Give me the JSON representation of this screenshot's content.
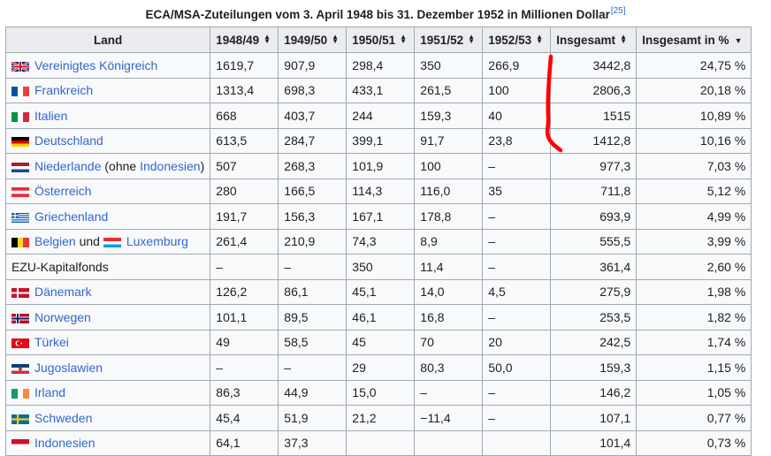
{
  "caption": {
    "title": "ECA/MSA-Zuteilungen vom 3. April 1948 bis 31. Dezember 1952 in Millionen Dollar",
    "ref": "[25]"
  },
  "table": {
    "headers": [
      "Land",
      "1948/49",
      "1949/50",
      "1950/51",
      "1951/52",
      "1952/53",
      "Insgesamt",
      "Insgesamt in %"
    ],
    "rows": [
      {
        "country": "Vereinigtes Königreich",
        "flag": "uk-flag-icon",
        "values": [
          "1619,7",
          "907,9",
          "298,4",
          "350",
          "266,9",
          "3442,8",
          "24,75 %"
        ]
      },
      {
        "country": "Frankreich",
        "flag": "france-flag-icon",
        "values": [
          "1313,4",
          "698,3",
          "433,1",
          "261,5",
          "100",
          "2806,3",
          "20,18 %"
        ]
      },
      {
        "country": "Italien",
        "flag": "italy-flag-icon",
        "values": [
          "668",
          "403,7",
          "244",
          "159,3",
          "40",
          "1515",
          "10,89 %"
        ]
      },
      {
        "country": "Deutschland",
        "flag": "germany-flag-icon",
        "values": [
          "613,5",
          "284,7",
          "399,1",
          "91,7",
          "23,8",
          "1412,8",
          "10,16 %"
        ]
      },
      {
        "country": "Niederlande",
        "suffix_pre": " (ohne ",
        "suffix_link": "Indonesien",
        "suffix_post": ")",
        "flag": "netherlands-flag-icon",
        "values": [
          "507",
          "268,3",
          "101,9",
          "100",
          "–",
          "977,3",
          "7,03 %"
        ]
      },
      {
        "country": "Österreich",
        "flag": "austria-flag-icon",
        "values": [
          "280",
          "166,5",
          "114,3",
          "116,0",
          "35",
          "711,8",
          "5,12 %"
        ]
      },
      {
        "country": "Griechenland",
        "flag": "greece-flag-icon",
        "values": [
          "191,7",
          "156,3",
          "167,1",
          "178,8",
          "–",
          "693,9",
          "4,99 %"
        ]
      },
      {
        "country": "Belgien",
        "mid": " und ",
        "country2": "Luxemburg",
        "flag": "belgium-flag-icon",
        "flag2": "luxembourg-flag-icon",
        "values": [
          "261,4",
          "210,9",
          "74,3",
          "8,9",
          "–",
          "555,5",
          "3,99 %"
        ]
      },
      {
        "country": "EZU-Kapitalfonds",
        "plain": true,
        "values": [
          "–",
          "–",
          "350",
          "11,4",
          "–",
          "361,4",
          "2,60 %"
        ]
      },
      {
        "country": "Dänemark",
        "flag": "denmark-flag-icon",
        "values": [
          "126,2",
          "86,1",
          "45,1",
          "14,0",
          "4,5",
          "275,9",
          "1,98 %"
        ]
      },
      {
        "country": "Norwegen",
        "flag": "norway-flag-icon",
        "values": [
          "101,1",
          "89,5",
          "46,1",
          "16,8",
          "–",
          "253,5",
          "1,82 %"
        ]
      },
      {
        "country": "Türkei",
        "flag": "turkey-flag-icon",
        "values": [
          "49",
          "58,5",
          "45",
          "70",
          "20",
          "242,5",
          "1,74 %"
        ]
      },
      {
        "country": "Jugoslawien",
        "flag": "yugoslavia-flag-icon",
        "values": [
          "–",
          "–",
          "29",
          "80,3",
          "50,0",
          "159,3",
          "1,15 %"
        ]
      },
      {
        "country": "Irland",
        "flag": "ireland-flag-icon",
        "values": [
          "86,3",
          "44,9",
          "15,0",
          "–",
          "–",
          "146,2",
          "1,05 %"
        ]
      },
      {
        "country": "Schweden",
        "flag": "sweden-flag-icon",
        "values": [
          "45,4",
          "51,9",
          "21,2",
          "−11,4",
          "–",
          "107,1",
          "0,77 %"
        ]
      },
      {
        "country": "Indonesien",
        "flag": "indonesia-flag-icon",
        "values": [
          "64,1",
          "37,3",
          "",
          "",
          "",
          "101,4",
          "0,73 %"
        ]
      }
    ]
  },
  "colors": {
    "link": "#3366cc",
    "header_bg": "#eaecf0",
    "cell_bg": "#f8f9fa",
    "border": "#a2a9b1",
    "annotation": "#ff0000"
  }
}
